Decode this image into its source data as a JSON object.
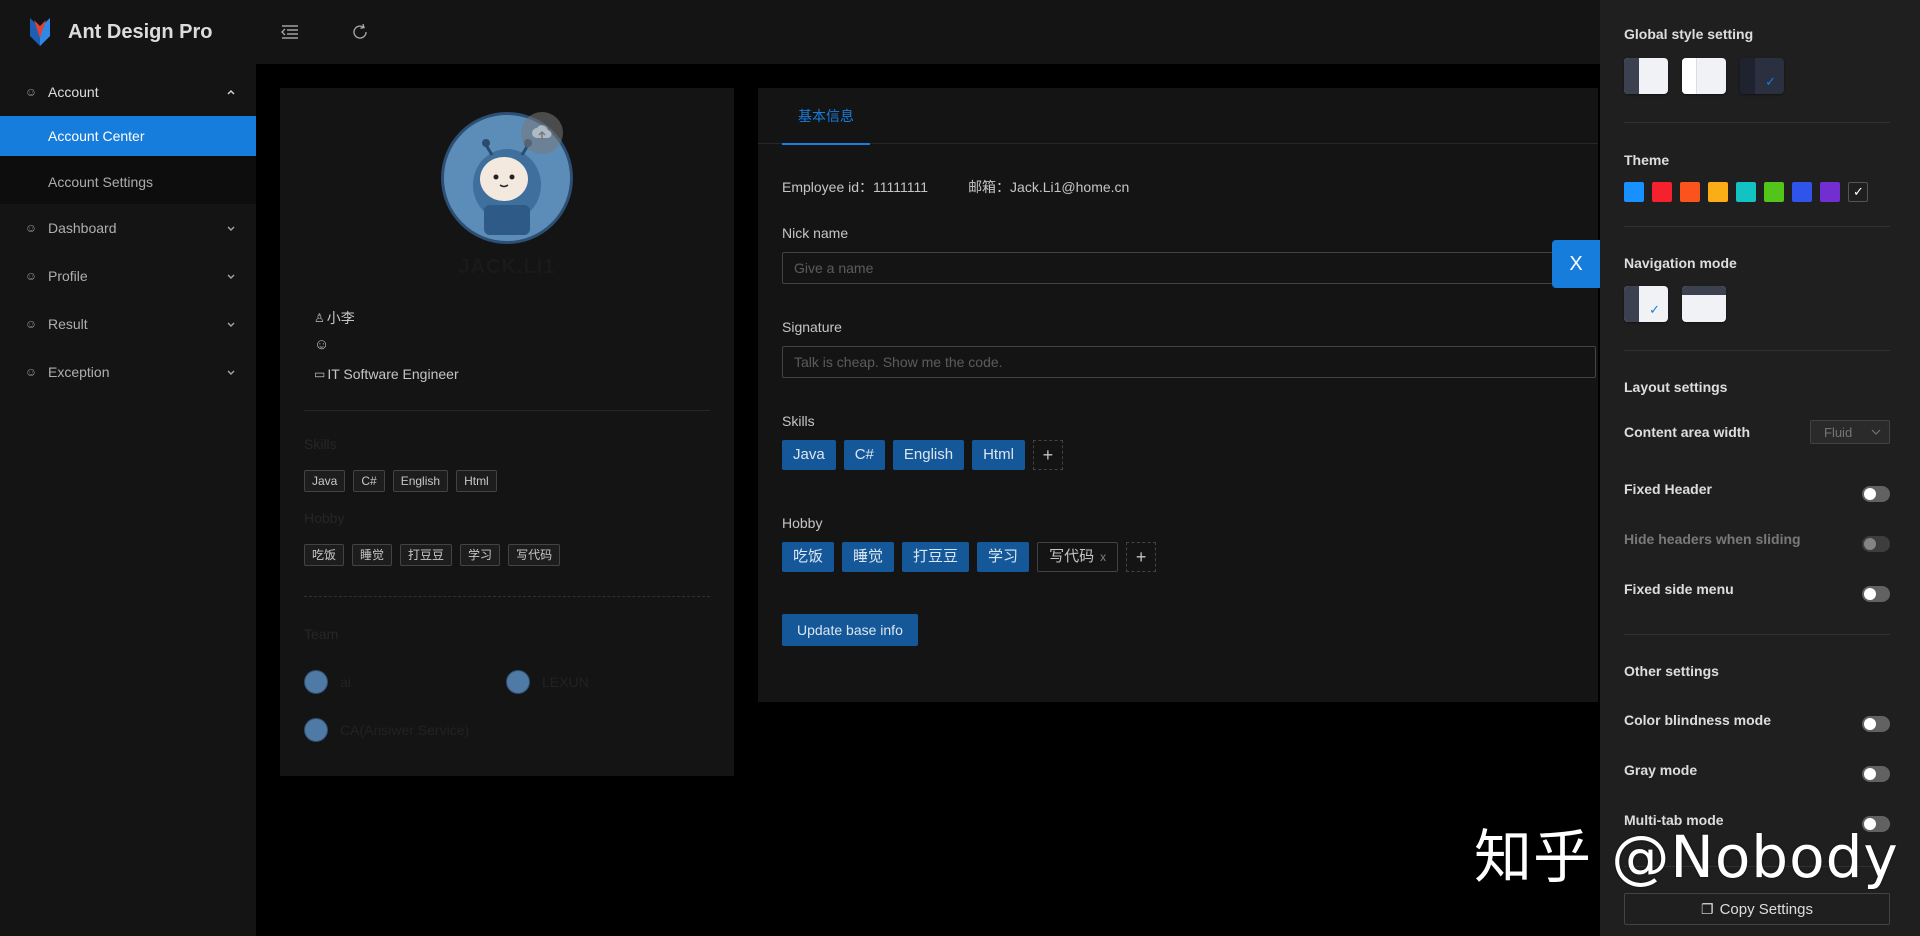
{
  "app": {
    "title": "Ant Design Pro"
  },
  "sidebar": {
    "items": [
      {
        "label": "Account",
        "icon": "smile-icon",
        "expanded": true,
        "children": [
          {
            "label": "Account Center",
            "active": true
          },
          {
            "label": "Account Settings",
            "active": false
          }
        ]
      },
      {
        "label": "Dashboard",
        "icon": "smile-icon"
      },
      {
        "label": "Profile",
        "icon": "smile-icon"
      },
      {
        "label": "Result",
        "icon": "smile-icon"
      },
      {
        "label": "Exception",
        "icon": "smile-icon"
      }
    ]
  },
  "header": {
    "collapse_icon": "menu-fold-icon",
    "reload_icon": "reload-icon"
  },
  "profile_card": {
    "name": "JACK.LI1",
    "nickname": "小李",
    "title": "IT Software Engineer",
    "skills_label": "Skills",
    "skills": [
      "Java",
      "C#",
      "English",
      "Html"
    ],
    "hobby_label": "Hobby",
    "hobbies": [
      "吃饭",
      "睡觉",
      "打豆豆",
      "学习",
      "写代码"
    ],
    "team_label": "Team",
    "team": [
      "ai",
      "LEXUN",
      "CA(Ansiwer Service)"
    ]
  },
  "form": {
    "tab": "基本信息",
    "employee_id": "Employee id：11111111",
    "email": "邮箱：Jack.Li1@home.cn",
    "nick_label": "Nick name",
    "nick_placeholder": "Give a name",
    "signature_label": "Signature",
    "signature_placeholder": "Talk is cheap. Show me the code.",
    "skills_label": "Skills",
    "skills": [
      "Java",
      "C#",
      "English",
      "Html"
    ],
    "hobby_label": "Hobby",
    "hobbies": [
      "吃饭",
      "睡觉",
      "打豆豆",
      "学习",
      "写代码"
    ],
    "add_symbol": "+",
    "remove_symbol": "x",
    "submit_label": "Update base info"
  },
  "drawer": {
    "close_symbol": "X",
    "global_style_title": "Global style setting",
    "theme_title": "Theme",
    "theme_colors": [
      "#1890ff",
      "#f5222d",
      "#fa541c",
      "#faad14",
      "#13c2c2",
      "#52c41a",
      "#2f54eb",
      "#722ed1",
      "#1f1f1f"
    ],
    "nav_mode_title": "Navigation mode",
    "layout_title": "Layout settings",
    "content_width_label": "Content area width",
    "content_width_value": "Fluid",
    "fixed_header_label": "Fixed Header",
    "hide_headers_label": "Hide headers when sliding",
    "fixed_side_menu_label": "Fixed side menu",
    "other_title": "Other settings",
    "color_blind_label": "Color blindness mode",
    "gray_mode_label": "Gray mode",
    "multi_tab_label": "Multi-tab mode",
    "copy_label": "Copy Settings",
    "check_symbol": "✓"
  },
  "watermark": "知乎 @Nobody"
}
